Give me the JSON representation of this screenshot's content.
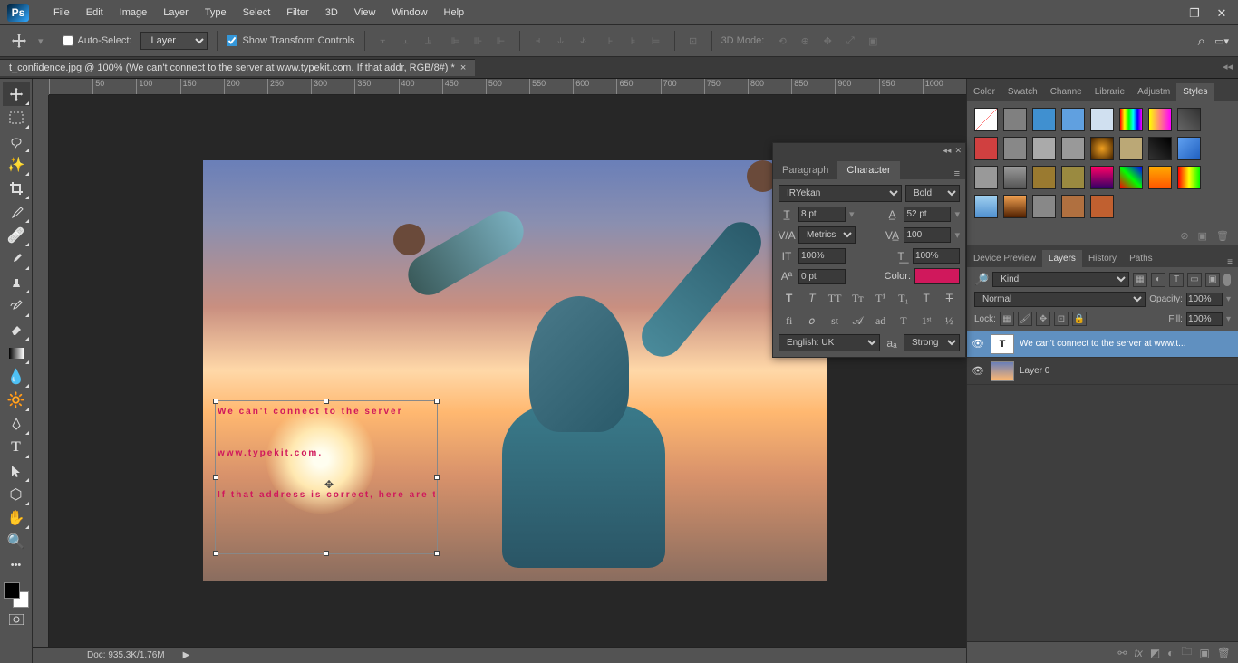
{
  "app": {
    "logo_text": "Ps"
  },
  "menu": [
    "File",
    "Edit",
    "Image",
    "Layer",
    "Type",
    "Select",
    "Filter",
    "3D",
    "View",
    "Window",
    "Help"
  ],
  "options": {
    "auto_select": "Auto-Select:",
    "auto_select_target": "Layer",
    "show_transform": "Show Transform Controls",
    "mode3d": "3D Mode:"
  },
  "doc_tab": "t_confidence.jpg @ 100% (We can't connect to the server at www.typekit.com. If that addr, RGB/8#) *",
  "ruler_ticks": [
    "",
    "50",
    "100",
    "150",
    "200",
    "250",
    "300",
    "350",
    "400",
    "450",
    "500",
    "550",
    "600",
    "650",
    "700",
    "750",
    "800",
    "850",
    "900",
    "950",
    "1000"
  ],
  "canvas_text": {
    "line1": "We can't connect to the server",
    "line2": "www.typekit.com.",
    "line3": "If that address is correct, here are three other"
  },
  "status": {
    "doc_info": "Doc: 935.3K/1.76M",
    "arrow": "▶"
  },
  "right_panels": {
    "top_tabs": [
      "Color",
      "Swatch",
      "Channe",
      "Librarie",
      "Adjustm",
      "Styles"
    ],
    "style_colors": [
      "linear-gradient(135deg,#fff 49%,#f00 50%,#fff 51%)",
      "#808080",
      "#4090d0",
      "#60a0e0",
      "#d0e0f0",
      "linear-gradient(90deg,#f00,#ff0,#0f0,#0ff,#00f,#f0f)",
      "linear-gradient(90deg,#ff0,#f0f)",
      "linear-gradient(45deg,#666,#333)",
      "#d04040",
      "#888",
      "#aaa",
      "#999",
      "radial-gradient(#f0a020,#402000)",
      "#bba876",
      "linear-gradient(45deg,#333,#000)",
      "linear-gradient(135deg,#60a0f0,#2060c0)",
      "#999",
      "linear-gradient(#999,#555)",
      "#9a7a30",
      "#9a8a40",
      "linear-gradient(#f06,#306)",
      "linear-gradient(45deg,#f00,#0f0,#00f)",
      "linear-gradient(#fa0,#f50)",
      "linear-gradient(90deg,#f00,#ff0,#0f0)",
      "linear-gradient(#a0d0f0,#5090d0)",
      "linear-gradient(#f0a050,#502000)",
      "#888",
      "#b07040",
      "#c06030"
    ],
    "layers_tabs": [
      "Device Preview",
      "Layers",
      "History",
      "Paths"
    ],
    "kind_label": "Kind",
    "blend_mode": "Normal",
    "opacity_label": "Opacity:",
    "opacity_value": "100%",
    "lock_label": "Lock:",
    "fill_label": "Fill:",
    "fill_value": "100%",
    "layers": [
      {
        "name": "We can't connect to the server at www.t...",
        "type": "text",
        "selected": true
      },
      {
        "name": "Layer 0",
        "type": "img",
        "selected": false
      }
    ]
  },
  "char_panel": {
    "tabs": [
      "Paragraph",
      "Character"
    ],
    "font": "IRYekan",
    "style": "Bold",
    "size": "8 pt",
    "leading": "52 pt",
    "kerning": "Metrics",
    "tracking": "100",
    "vscale": "100%",
    "hscale": "100%",
    "baseline": "0 pt",
    "color_label": "Color:",
    "lang": "English: UK",
    "aa": "Strong"
  }
}
